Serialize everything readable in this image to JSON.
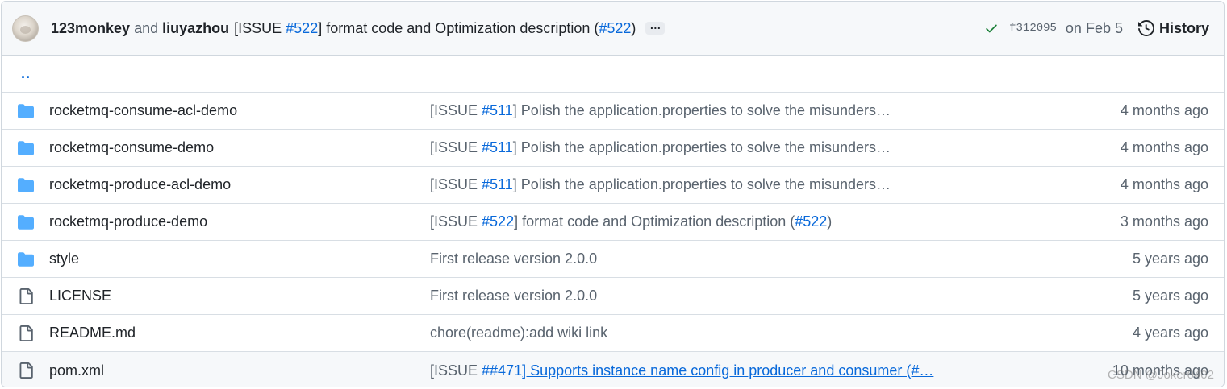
{
  "commit": {
    "author1": "123monkey",
    "and_text": "and",
    "author2": "liuyazhou",
    "message_prefix": "[ISSUE ",
    "message_issue": "#522",
    "message_body": "] format code and Optimization description (",
    "message_pr": "#522",
    "message_suffix": ")",
    "ellipsis": "…",
    "status": "success",
    "sha": "f312095",
    "date": "on Feb 5",
    "history_label": "History"
  },
  "parent_dir": "..",
  "files": [
    {
      "type": "folder",
      "name": "rocketmq-consume-acl-demo",
      "msg_prefix": "[ISSUE ",
      "msg_link": "#511",
      "msg_rest": "] Polish the application.properties to solve the misunders…",
      "age": "4 months ago"
    },
    {
      "type": "folder",
      "name": "rocketmq-consume-demo",
      "msg_prefix": "[ISSUE ",
      "msg_link": "#511",
      "msg_rest": "] Polish the application.properties to solve the misunders…",
      "age": "4 months ago"
    },
    {
      "type": "folder",
      "name": "rocketmq-produce-acl-demo",
      "msg_prefix": "[ISSUE ",
      "msg_link": "#511",
      "msg_rest": "] Polish the application.properties to solve the misunders…",
      "age": "4 months ago"
    },
    {
      "type": "folder",
      "name": "rocketmq-produce-demo",
      "msg_prefix": "[ISSUE ",
      "msg_link": "#522",
      "msg_rest": "] format code and Optimization description (",
      "msg_link2": "#522",
      "msg_suffix": ")",
      "age": "3 months ago"
    },
    {
      "type": "folder",
      "name": "style",
      "msg_plain": "First release version 2.0.0",
      "age": "5 years ago"
    },
    {
      "type": "file",
      "name": "LICENSE",
      "msg_plain": "First release version 2.0.0",
      "age": "5 years ago"
    },
    {
      "type": "file",
      "name": "README.md",
      "msg_plain": "chore(readme):add wiki link",
      "age": "4 years ago"
    },
    {
      "type": "file",
      "name": "pom.xml",
      "msg_prefix": "[ISSUE ",
      "msg_link": "##471",
      "msg_ulink": "] Supports instance name config in producer and consumer (#…",
      "age": "10 months ago"
    }
  ],
  "watermark": "CSDN @Joker0402",
  "colors": {
    "link": "#0969da",
    "folder": "#54aeff",
    "success": "#1a7f37",
    "muted": "#59636e"
  }
}
